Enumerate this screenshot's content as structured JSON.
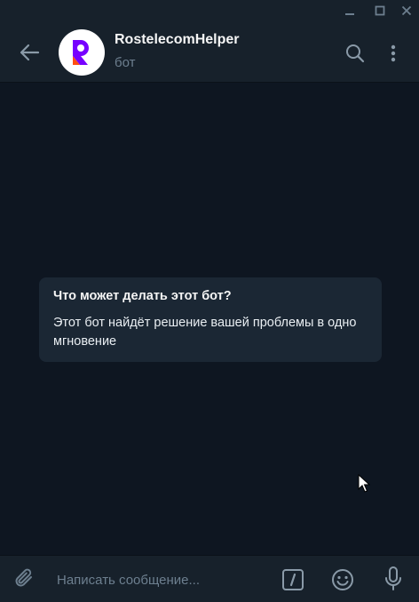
{
  "window": {
    "minimize_icon": "minimize-icon",
    "maximize_icon": "maximize-icon",
    "close_icon": "close-icon"
  },
  "header": {
    "title": "RostelecomHelper",
    "subtitle": "бот",
    "back_icon": "arrow-left-icon",
    "search_icon": "search-icon",
    "more_icon": "more-vertical-icon"
  },
  "bot_info": {
    "title": "Что может делать этот бот?",
    "description": "Этот бот найдёт решение вашей проблемы в одно мгновение"
  },
  "composer": {
    "placeholder": "Написать сообщение...",
    "attach_icon": "paperclip-icon",
    "commands_icon": "slash-commands-icon",
    "emoji_icon": "smile-icon",
    "mic_icon": "microphone-icon"
  },
  "colors": {
    "background": "#0e1621",
    "panel": "#17212b",
    "card": "#1b2734",
    "brand_purple": "#7700ff",
    "brand_orange": "#ff4f12",
    "icon": "#6d7f8f"
  }
}
